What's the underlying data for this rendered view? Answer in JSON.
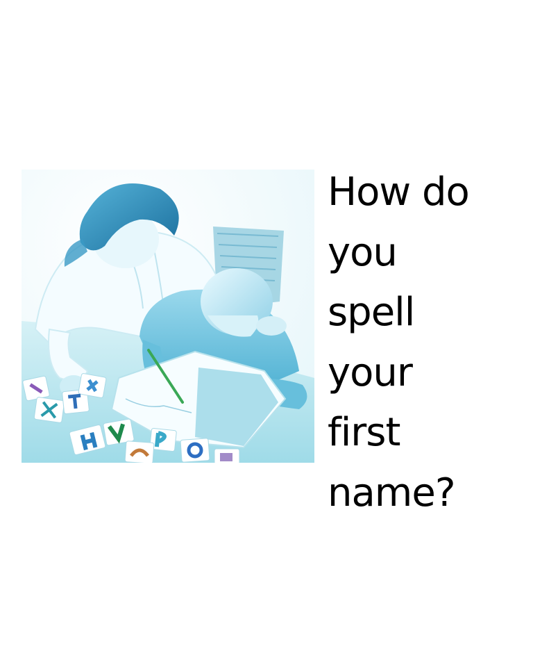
{
  "slide": {
    "question_lines": [
      "How do",
      "you",
      "spell",
      "your",
      "first",
      "name?"
    ],
    "photo": {
      "subject": "teacher-helping-child-write-with-letter-cards",
      "tint_colors": {
        "background": "#f2fbfd",
        "table": "#b9e6ef",
        "shirt_child": "#6cc3dd",
        "hair": "#2f8fc0",
        "shadow": "#0f6e9b"
      }
    }
  }
}
